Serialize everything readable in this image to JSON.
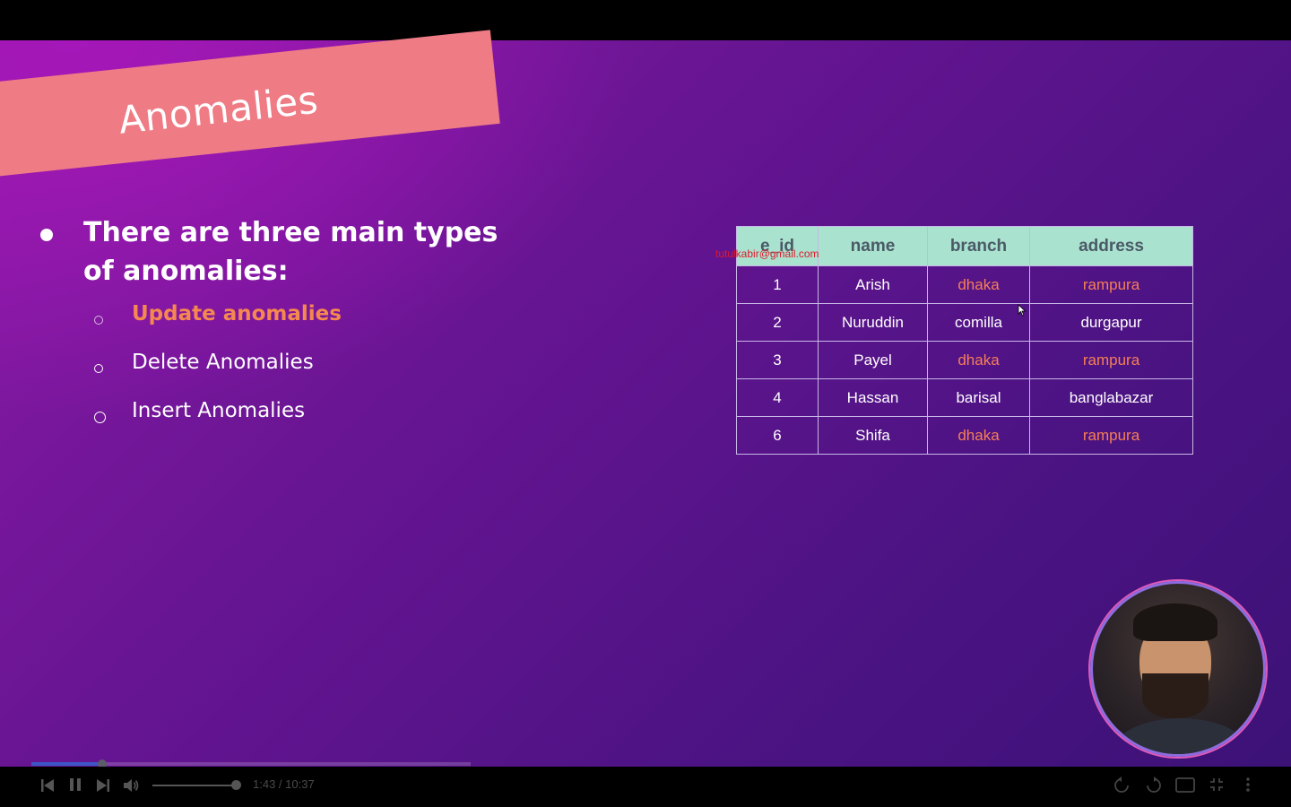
{
  "slide": {
    "banner_title": "Anomalies",
    "main_point": "There are three main types of anomalies:",
    "sub_points": [
      {
        "label": "Update anomalies",
        "highlighted": true
      },
      {
        "label": "Delete Anomalies",
        "highlighted": false
      },
      {
        "label": "Insert Anomalies",
        "highlighted": false
      }
    ],
    "watermark": "tutulkabir@gmail.com"
  },
  "table": {
    "headers": [
      "e_id",
      "name",
      "branch",
      "address"
    ],
    "rows": [
      [
        "1",
        "Arish",
        "dhaka",
        "rampura"
      ],
      [
        "2",
        "Nuruddin",
        "comilla",
        "durgapur"
      ],
      [
        "3",
        "Payel",
        "dhaka",
        "rampura"
      ],
      [
        "4",
        "Hassan",
        "barisal",
        "banglabazar"
      ],
      [
        "6",
        "Shifa",
        "dhaka",
        "rampura"
      ]
    ]
  },
  "player": {
    "time": "1:43 / 10:37",
    "progress_fraction": 0.162,
    "icons": [
      "skip-back-icon",
      "pause-icon",
      "skip-forward-icon",
      "volume-icon",
      "rewind-icon",
      "forward-icon",
      "captions-icon",
      "fullscreen-exit-icon",
      "more-icon"
    ]
  },
  "colors": {
    "banner": "#ef7b85",
    "highlight": "#f5884f",
    "table_header_bg": "#a9e2cf",
    "watermark": "#e0182a",
    "progress_played": "#3d55c6"
  }
}
